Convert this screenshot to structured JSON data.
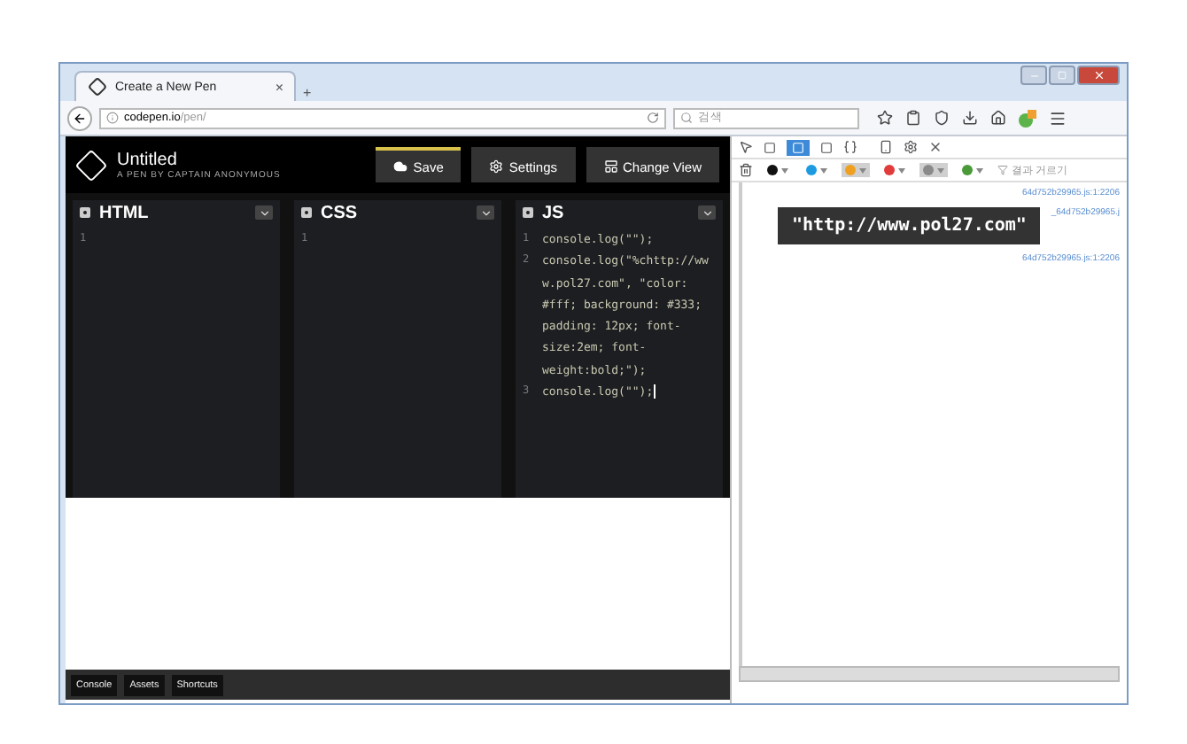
{
  "browser": {
    "tab": {
      "title": "Create a New Pen",
      "close": "×"
    },
    "new_tab": "+",
    "url": {
      "host": "codepen.io",
      "path": "/pen/"
    },
    "search": {
      "placeholder": "검색"
    }
  },
  "pen": {
    "title": "Untitled",
    "subtitle": "A PEN BY CAPTAIN ANONYMOUS",
    "buttons": [
      {
        "label": "Save",
        "kind": "cloud",
        "selected": true
      },
      {
        "label": "Settings",
        "kind": "gear",
        "selected": false
      },
      {
        "label": "Change View",
        "kind": "layout",
        "selected": false
      }
    ]
  },
  "editors": [
    {
      "title": "HTML",
      "lines": [
        {
          "number": "1"
        }
      ]
    },
    {
      "title": "CSS",
      "lines": [
        {
          "number": "1"
        }
      ]
    },
    {
      "title": "JS",
      "lines": [
        {
          "number": "1",
          "code": "console.log(\"\");"
        },
        {
          "number": "2",
          "code": "console.log(\"%chttp://www.pol27.com\", \"color: #fff; background: #333; padding: 12px; font-size:2em; font-weight:bold;\");"
        },
        {
          "number": "3",
          "code": "console.log(\"\");"
        }
      ]
    }
  ],
  "bottom_bar": [
    "Console",
    "Assets",
    "Shortcuts"
  ],
  "devtools": {
    "levels": [
      {
        "color": "#111111",
        "selected": false
      },
      {
        "color": "#1e9be0",
        "selected": false
      },
      {
        "color": "#f0a020",
        "selected": true
      },
      {
        "color": "#e23b3b",
        "selected": false
      },
      {
        "color": "#8a8a8a",
        "selected": true
      },
      {
        "color": "#4a9a3a",
        "selected": false
      }
    ],
    "filter": {
      "placeholder": "결과 거르기"
    },
    "messages": [
      {
        "kind": "plain",
        "source": "64d752b29965.js:1:2206"
      },
      {
        "kind": "styled",
        "text": "\"http://www.pol27.com\"",
        "source": "_64d752b29965.j"
      },
      {
        "kind": "plain",
        "source": "64d752b29965.js:1:2206"
      }
    ]
  }
}
